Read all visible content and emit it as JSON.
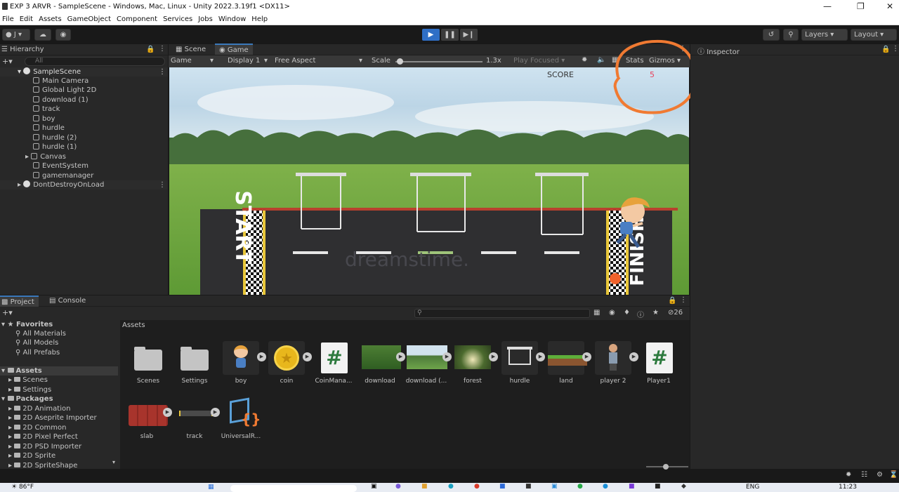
{
  "window": {
    "title": "EXP 3 ARVR - SampleScene - Windows, Mac, Linux - Unity 2022.3.19f1 <DX11>"
  },
  "menu": [
    "File",
    "Edit",
    "Assets",
    "GameObject",
    "Component",
    "Services",
    "Jobs",
    "Window",
    "Help"
  ],
  "toolbar": {
    "account": "J",
    "layers": "Layers",
    "layout": "Layout"
  },
  "hierarchy": {
    "tab": "Hierarchy",
    "search_placeholder": "All",
    "scene": "SampleScene",
    "items": [
      "Main Camera",
      "Global Light 2D",
      "download (1)",
      "track",
      "boy",
      "hurdle",
      "hurdle (2)",
      "hurdle (1)",
      "Canvas",
      "EventSystem",
      "gamemanager"
    ],
    "dontdestroy": "DontDestroyOnLoad"
  },
  "scene_tabs": {
    "scene": "Scene",
    "game": "Game"
  },
  "game_bar": {
    "mode": "Game",
    "display": "Display 1",
    "aspect": "Free Aspect",
    "scale_label": "Scale",
    "scale_value": "1.3x",
    "play_focused": "Play Focused",
    "stats": "Stats",
    "gizmos": "Gizmos"
  },
  "game": {
    "score_label": "SCORE",
    "score_value": "5",
    "start_text": "START",
    "finish_text": "FINISH",
    "watermark": "dreamstime."
  },
  "inspector": {
    "tab": "Inspector"
  },
  "project": {
    "tab_project": "Project",
    "tab_console": "Console",
    "count": "26",
    "favorites": {
      "label": "Favorites",
      "items": [
        "All Materials",
        "All Models",
        "All Prefabs"
      ]
    },
    "assets_root": {
      "label": "Assets",
      "items": [
        "Scenes",
        "Settings"
      ]
    },
    "packages": {
      "label": "Packages",
      "items": [
        "2D Animation",
        "2D Aseprite Importer",
        "2D Common",
        "2D Pixel Perfect",
        "2D PSD Importer",
        "2D Sprite",
        "2D SpriteShape"
      ]
    },
    "breadcrumb": "Assets",
    "assets": [
      "Scenes",
      "Settings",
      "boy",
      "coin",
      "CoinMana...",
      "download",
      "download (...",
      "forest",
      "hurdle",
      "land",
      "player 2",
      "Player1",
      "slab",
      "track",
      "UniversalR..."
    ]
  },
  "taskbar": {
    "weather": "86°F",
    "lang": "ENG",
    "time": "11:23"
  },
  "colors": {
    "accent": "#3a79bb",
    "play_active": "#2f6fc6",
    "score": "#e8405a",
    "annotation": "#f07a32"
  }
}
